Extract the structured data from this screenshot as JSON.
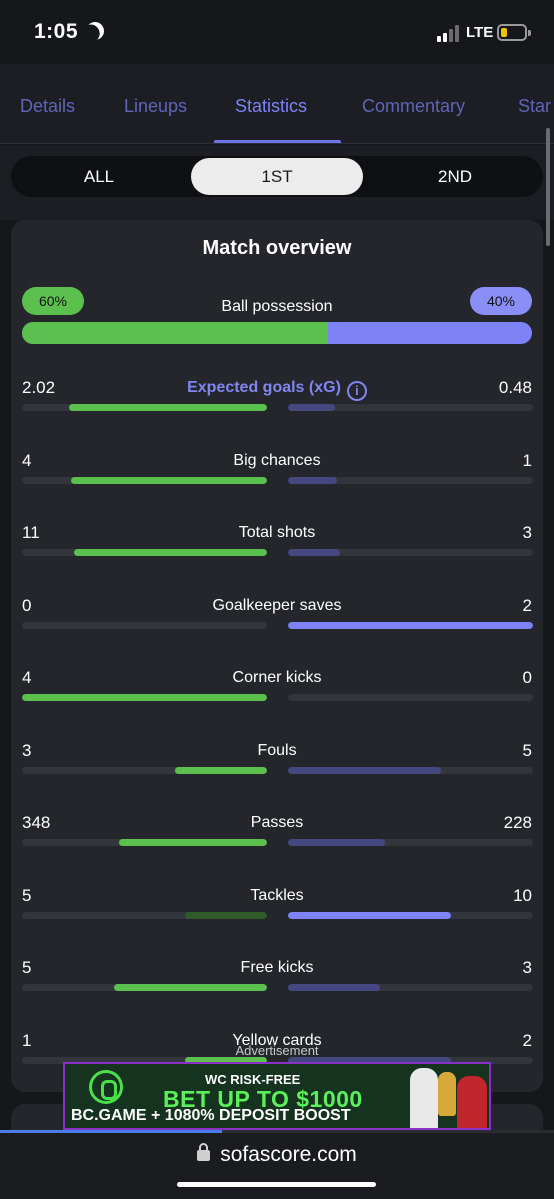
{
  "status_bar": {
    "time": "1:05",
    "network": "LTE",
    "colors": {
      "battery": "#f0c400"
    }
  },
  "tabs": [
    {
      "label": "Details",
      "active": false
    },
    {
      "label": "Lineups",
      "active": false
    },
    {
      "label": "Statistics",
      "active": true
    },
    {
      "label": "Commentary",
      "active": false
    },
    {
      "label": "Star",
      "active": false
    }
  ],
  "period": {
    "options": [
      "ALL",
      "1ST",
      "2ND"
    ],
    "selected": "1ST"
  },
  "overview": {
    "title": "Match overview",
    "possession": {
      "label": "Ball possession",
      "home": "60%",
      "away": "40%",
      "home_pct": 60
    },
    "stats": [
      {
        "name": "Expected goals (xG)",
        "home": "2.02",
        "away": "0.48",
        "home_frac": 0.81,
        "away_frac": 0.19,
        "highlight": "xg"
      },
      {
        "name": "Big chances",
        "home": "4",
        "away": "1",
        "home_frac": 0.8,
        "away_frac": 0.2
      },
      {
        "name": "Total shots",
        "home": "11",
        "away": "3",
        "home_frac": 0.786,
        "away_frac": 0.214
      },
      {
        "name": "Goalkeeper saves",
        "home": "0",
        "away": "2",
        "home_frac": 0.0,
        "away_frac": 1.0,
        "away_strong": true
      },
      {
        "name": "Corner kicks",
        "home": "4",
        "away": "0",
        "home_frac": 1.0,
        "away_frac": 0.0
      },
      {
        "name": "Fouls",
        "home": "3",
        "away": "5",
        "home_frac": 0.375,
        "away_frac": 0.625
      },
      {
        "name": "Passes",
        "home": "348",
        "away": "228",
        "home_frac": 0.604,
        "away_frac": 0.396
      },
      {
        "name": "Tackles",
        "home": "5",
        "away": "10",
        "home_frac": 0.333,
        "away_frac": 0.667,
        "away_strong": true,
        "home_weak": true
      },
      {
        "name": "Free kicks",
        "home": "5",
        "away": "3",
        "home_frac": 0.625,
        "away_frac": 0.375
      },
      {
        "name": "Yellow cards",
        "home": "1",
        "away": "2",
        "home_frac": 0.333,
        "away_frac": 0.667
      }
    ],
    "colors": {
      "home": "#5cc04f",
      "home_dim": "#2f5b2b",
      "away": "#7d82f7",
      "away_dim": "#454880"
    }
  },
  "ad": {
    "label": "Advertisement",
    "line1": "WC RISK-FREE",
    "line2": "BET UP TO $1000",
    "line3": "BC.GAME + 1080% DEPOSIT BOOST"
  },
  "browser": {
    "url": "sofascore.com",
    "load_progress": 0.4
  }
}
